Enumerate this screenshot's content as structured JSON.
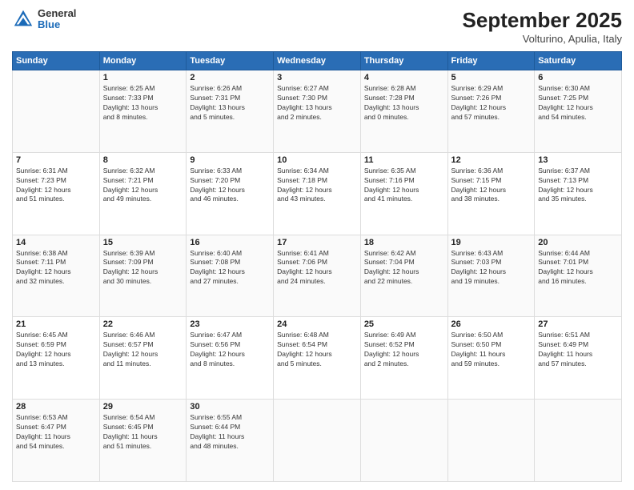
{
  "header": {
    "logo_general": "General",
    "logo_blue": "Blue",
    "month": "September 2025",
    "location": "Volturino, Apulia, Italy"
  },
  "days_of_week": [
    "Sunday",
    "Monday",
    "Tuesday",
    "Wednesday",
    "Thursday",
    "Friday",
    "Saturday"
  ],
  "weeks": [
    [
      {
        "day": "",
        "info": ""
      },
      {
        "day": "1",
        "info": "Sunrise: 6:25 AM\nSunset: 7:33 PM\nDaylight: 13 hours\nand 8 minutes."
      },
      {
        "day": "2",
        "info": "Sunrise: 6:26 AM\nSunset: 7:31 PM\nDaylight: 13 hours\nand 5 minutes."
      },
      {
        "day": "3",
        "info": "Sunrise: 6:27 AM\nSunset: 7:30 PM\nDaylight: 13 hours\nand 2 minutes."
      },
      {
        "day": "4",
        "info": "Sunrise: 6:28 AM\nSunset: 7:28 PM\nDaylight: 13 hours\nand 0 minutes."
      },
      {
        "day": "5",
        "info": "Sunrise: 6:29 AM\nSunset: 7:26 PM\nDaylight: 12 hours\nand 57 minutes."
      },
      {
        "day": "6",
        "info": "Sunrise: 6:30 AM\nSunset: 7:25 PM\nDaylight: 12 hours\nand 54 minutes."
      }
    ],
    [
      {
        "day": "7",
        "info": "Sunrise: 6:31 AM\nSunset: 7:23 PM\nDaylight: 12 hours\nand 51 minutes."
      },
      {
        "day": "8",
        "info": "Sunrise: 6:32 AM\nSunset: 7:21 PM\nDaylight: 12 hours\nand 49 minutes."
      },
      {
        "day": "9",
        "info": "Sunrise: 6:33 AM\nSunset: 7:20 PM\nDaylight: 12 hours\nand 46 minutes."
      },
      {
        "day": "10",
        "info": "Sunrise: 6:34 AM\nSunset: 7:18 PM\nDaylight: 12 hours\nand 43 minutes."
      },
      {
        "day": "11",
        "info": "Sunrise: 6:35 AM\nSunset: 7:16 PM\nDaylight: 12 hours\nand 41 minutes."
      },
      {
        "day": "12",
        "info": "Sunrise: 6:36 AM\nSunset: 7:15 PM\nDaylight: 12 hours\nand 38 minutes."
      },
      {
        "day": "13",
        "info": "Sunrise: 6:37 AM\nSunset: 7:13 PM\nDaylight: 12 hours\nand 35 minutes."
      }
    ],
    [
      {
        "day": "14",
        "info": "Sunrise: 6:38 AM\nSunset: 7:11 PM\nDaylight: 12 hours\nand 32 minutes."
      },
      {
        "day": "15",
        "info": "Sunrise: 6:39 AM\nSunset: 7:09 PM\nDaylight: 12 hours\nand 30 minutes."
      },
      {
        "day": "16",
        "info": "Sunrise: 6:40 AM\nSunset: 7:08 PM\nDaylight: 12 hours\nand 27 minutes."
      },
      {
        "day": "17",
        "info": "Sunrise: 6:41 AM\nSunset: 7:06 PM\nDaylight: 12 hours\nand 24 minutes."
      },
      {
        "day": "18",
        "info": "Sunrise: 6:42 AM\nSunset: 7:04 PM\nDaylight: 12 hours\nand 22 minutes."
      },
      {
        "day": "19",
        "info": "Sunrise: 6:43 AM\nSunset: 7:03 PM\nDaylight: 12 hours\nand 19 minutes."
      },
      {
        "day": "20",
        "info": "Sunrise: 6:44 AM\nSunset: 7:01 PM\nDaylight: 12 hours\nand 16 minutes."
      }
    ],
    [
      {
        "day": "21",
        "info": "Sunrise: 6:45 AM\nSunset: 6:59 PM\nDaylight: 12 hours\nand 13 minutes."
      },
      {
        "day": "22",
        "info": "Sunrise: 6:46 AM\nSunset: 6:57 PM\nDaylight: 12 hours\nand 11 minutes."
      },
      {
        "day": "23",
        "info": "Sunrise: 6:47 AM\nSunset: 6:56 PM\nDaylight: 12 hours\nand 8 minutes."
      },
      {
        "day": "24",
        "info": "Sunrise: 6:48 AM\nSunset: 6:54 PM\nDaylight: 12 hours\nand 5 minutes."
      },
      {
        "day": "25",
        "info": "Sunrise: 6:49 AM\nSunset: 6:52 PM\nDaylight: 12 hours\nand 2 minutes."
      },
      {
        "day": "26",
        "info": "Sunrise: 6:50 AM\nSunset: 6:50 PM\nDaylight: 11 hours\nand 59 minutes."
      },
      {
        "day": "27",
        "info": "Sunrise: 6:51 AM\nSunset: 6:49 PM\nDaylight: 11 hours\nand 57 minutes."
      }
    ],
    [
      {
        "day": "28",
        "info": "Sunrise: 6:53 AM\nSunset: 6:47 PM\nDaylight: 11 hours\nand 54 minutes."
      },
      {
        "day": "29",
        "info": "Sunrise: 6:54 AM\nSunset: 6:45 PM\nDaylight: 11 hours\nand 51 minutes."
      },
      {
        "day": "30",
        "info": "Sunrise: 6:55 AM\nSunset: 6:44 PM\nDaylight: 11 hours\nand 48 minutes."
      },
      {
        "day": "",
        "info": ""
      },
      {
        "day": "",
        "info": ""
      },
      {
        "day": "",
        "info": ""
      },
      {
        "day": "",
        "info": ""
      }
    ]
  ]
}
